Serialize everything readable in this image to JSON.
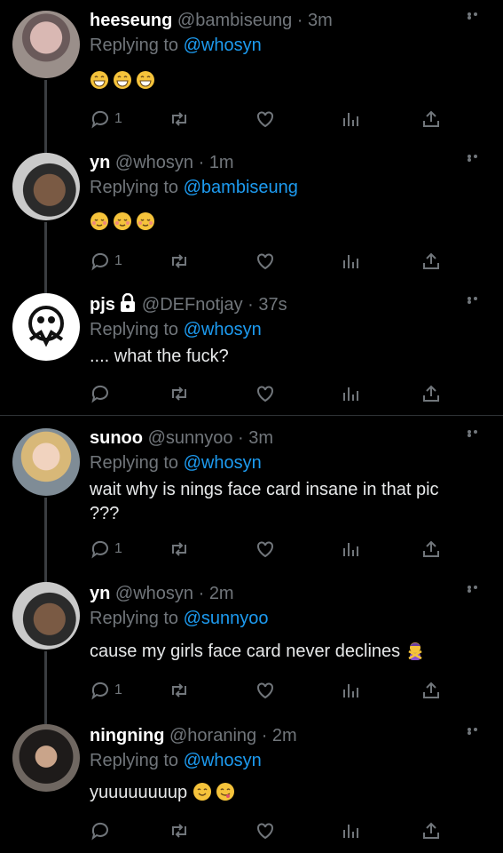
{
  "colors": {
    "background": "#000000",
    "text": "#e7e9ea",
    "muted": "#71767b",
    "link": "#1d9bf0"
  },
  "tweets": [
    {
      "name": "heeseung",
      "handle": "@bambiseung",
      "time": "3m",
      "replying_prefix": "Replying to",
      "replying_to": "@whosyn",
      "text": "",
      "emojis": [
        "grinning-face-emoji",
        "grinning-face-emoji",
        "grinning-face-emoji"
      ],
      "reply_count": "1",
      "avatar": "avatar-photo"
    },
    {
      "name": "yn",
      "handle": "@whosyn",
      "time": "1m",
      "replying_prefix": "Replying to",
      "replying_to": "@bambiseung",
      "text": "",
      "emojis": [
        "relieved-face-emoji",
        "relieved-face-emoji",
        "relieved-face-emoji"
      ],
      "reply_count": "1",
      "avatar": "avatar-leaf-photo"
    },
    {
      "name": "pjs",
      "protected": true,
      "handle": "@DEFnotjay",
      "time": "37s",
      "replying_prefix": "Replying to",
      "replying_to": "@whosyn",
      "text": ".... what the fuck?",
      "emojis": [],
      "reply_count": "",
      "avatar": "avatar-cartoon"
    },
    {
      "name": "sunoo",
      "handle": "@sunnyoo",
      "time": "3m",
      "replying_prefix": "Replying to",
      "replying_to": "@whosyn",
      "text": "wait why is nings face card insane in that pic ???",
      "emojis": [],
      "reply_count": "1",
      "avatar": "avatar-photo-blond"
    },
    {
      "name": "yn",
      "handle": "@whosyn",
      "time": "2m",
      "replying_prefix": "Replying to",
      "replying_to": "@sunnyoo",
      "text": "cause my girls face card never declines",
      "emojis": [
        "person-gesturing-no-emoji"
      ],
      "reply_count": "1",
      "avatar": "avatar-leaf-photo"
    },
    {
      "name": "ningning",
      "handle": "@horaning",
      "time": "2m",
      "replying_prefix": "Replying to",
      "replying_to": "@whosyn",
      "text": "yuuuuuuuup",
      "emojis": [
        "smiling-face-emoji",
        "yummy-face-emoji"
      ],
      "reply_count": "",
      "avatar": "avatar-photo-dark"
    }
  ]
}
